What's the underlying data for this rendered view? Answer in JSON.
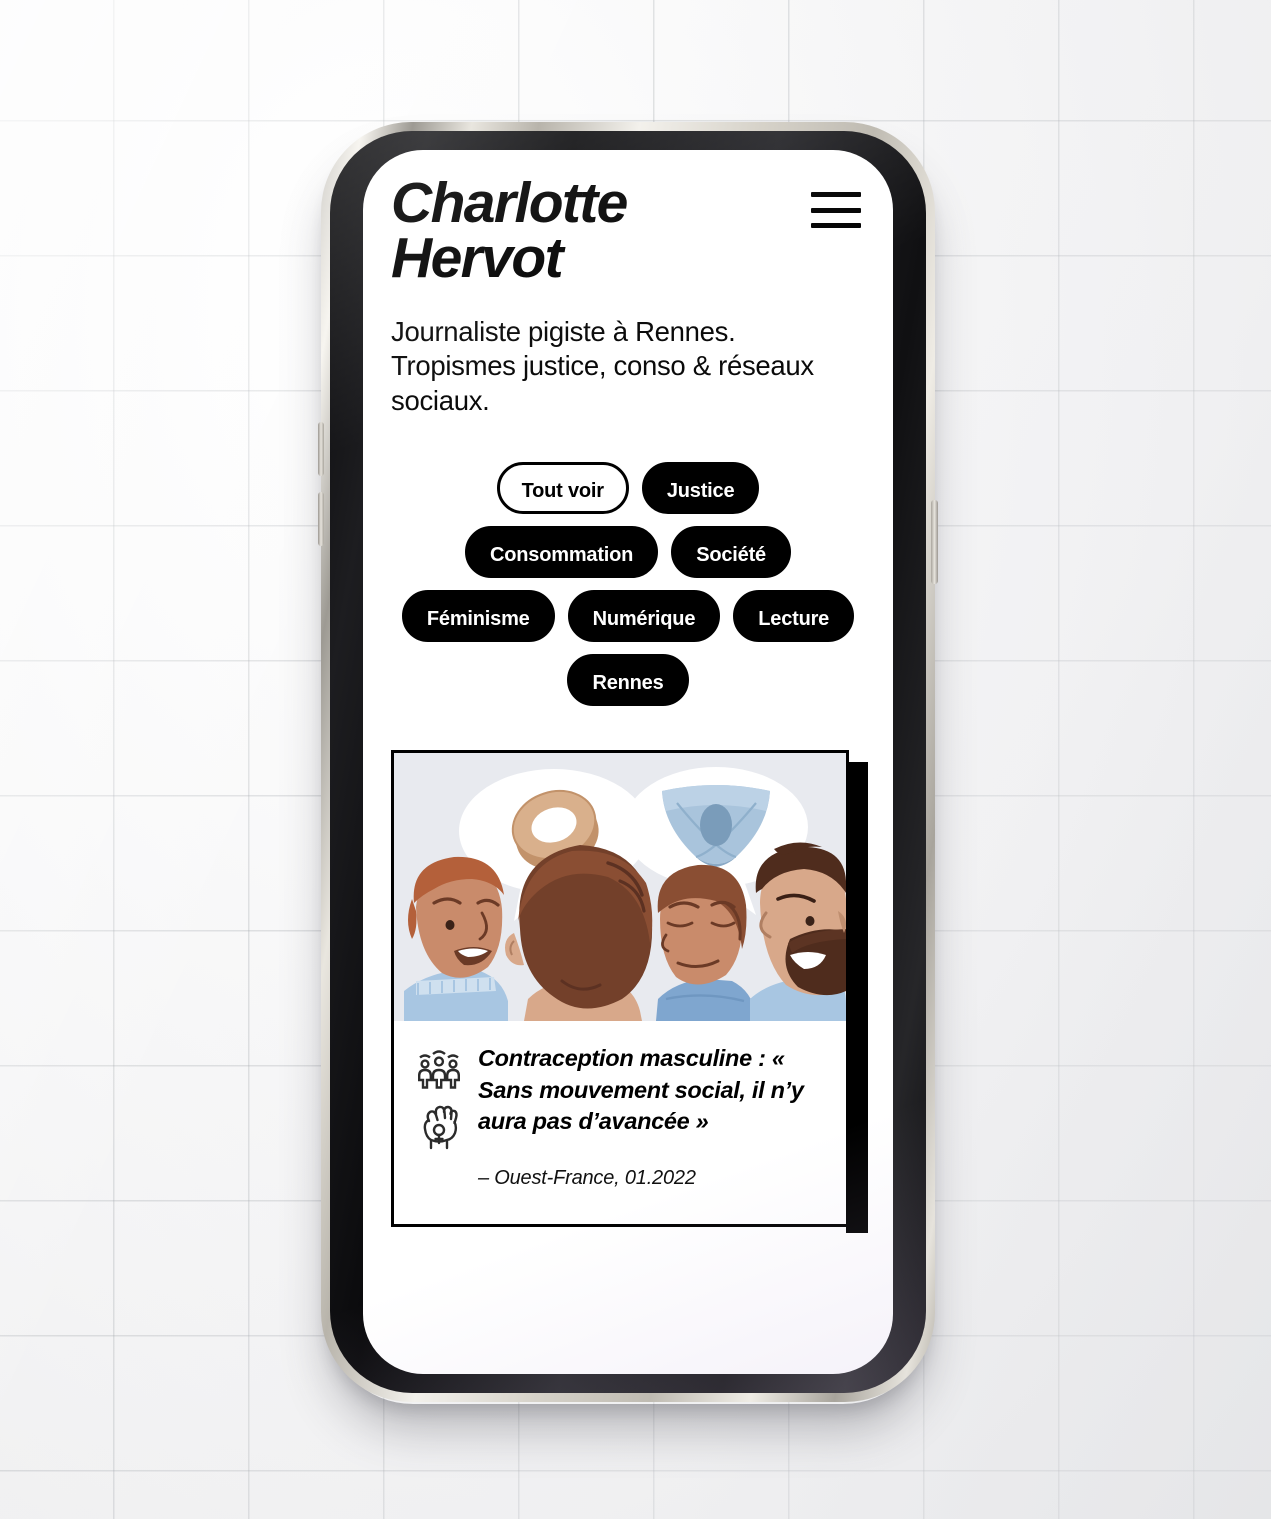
{
  "site": {
    "brand_line1": "Charlotte",
    "brand_line2": "Hervot",
    "tagline": "Journaliste pigiste à Rennes. Tropismes justice, conso & réseaux sociaux.",
    "menu_icon": "hamburger-menu-icon"
  },
  "filters": {
    "row1": [
      {
        "label": "Tout voir",
        "active": true
      },
      {
        "label": "Justice",
        "active": false
      },
      {
        "label": "Consommation",
        "active": false
      }
    ],
    "row2": [
      {
        "label": "Société",
        "active": false
      },
      {
        "label": "Féminisme",
        "active": false
      },
      {
        "label": "Numérique",
        "active": false
      }
    ],
    "row3": [
      {
        "label": "Lecture",
        "active": false
      },
      {
        "label": "Rennes",
        "active": false
      }
    ]
  },
  "article": {
    "title": "Contraception masculine : « Sans mouvement social, il n’y aura pas d’avancée »",
    "source": "– Ouest-France, 01.2022",
    "icons": [
      "group-of-people-icon",
      "feminist-raised-fist-icon"
    ],
    "illustration_alt": "Quatre hommes discutent, bulles montrant un anneau contraceptif et un slip chauffant"
  },
  "colors": {
    "accent": "#000000",
    "page_bg": "#ffffff",
    "illustration_bg": "#e8eaef",
    "skin_light": "#d79b7c",
    "skin_mid": "#c98b6b",
    "hair_dark": "#6b3a26",
    "hair_red": "#b4603a",
    "shirt_blue": "#7fa6cf",
    "ring_tan": "#d9b08c",
    "brief_blue": "#9fbdd8"
  }
}
